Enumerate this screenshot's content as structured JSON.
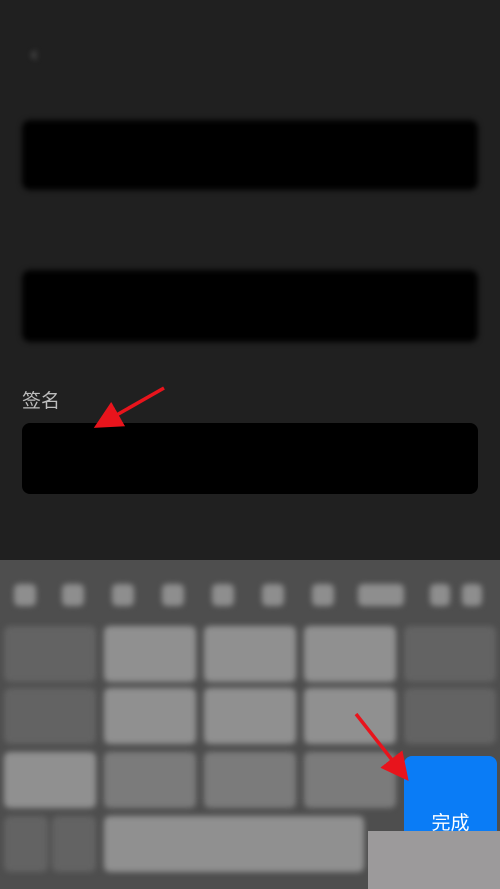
{
  "nav": {
    "back_icon": "chevron-left-icon",
    "save_label": ""
  },
  "form": {
    "nickname_label": "",
    "nickname_value": "",
    "birthday_label": "",
    "birthday_value": "",
    "signature_label": "签名",
    "signature_value": "",
    "hint": ""
  },
  "keyboard": {
    "done_label": "完成",
    "accent_color": "#0a7cf6"
  },
  "annotations": {
    "arrow_color": "#e8141c"
  }
}
